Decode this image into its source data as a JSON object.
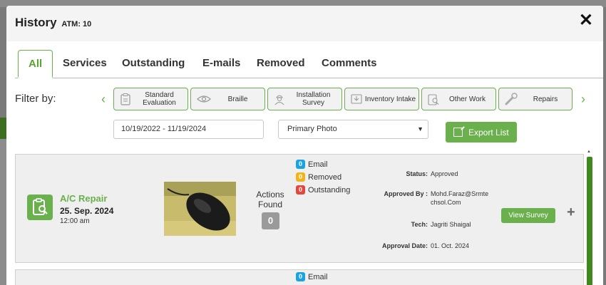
{
  "modal": {
    "title": "History",
    "subtitle": "ATM: 10",
    "close_label": "✕"
  },
  "tabs": [
    {
      "label": "All",
      "active": true
    },
    {
      "label": "Services"
    },
    {
      "label": "Outstanding"
    },
    {
      "label": "E-mails"
    },
    {
      "label": "Removed"
    },
    {
      "label": "Comments"
    }
  ],
  "filter": {
    "label": "Filter by:",
    "prev": "‹",
    "next": "›",
    "chips": [
      {
        "label": "Standard Evaluation",
        "icon": "clipboard-icon"
      },
      {
        "label": "Braille",
        "icon": "eye-icon"
      },
      {
        "label": "Installation Survey",
        "icon": "worker-icon"
      },
      {
        "label": "Inventory Intake",
        "icon": "inbox-icon"
      },
      {
        "label": "Other Work",
        "icon": "clipboard-search-icon"
      },
      {
        "label": "Repairs",
        "icon": "wrench-icon"
      }
    ]
  },
  "date_range": "10/19/2022 - 11/19/2024",
  "photo_select": {
    "value": "Primary Photo",
    "arrow": "▼"
  },
  "export": {
    "label": "Export List"
  },
  "items": [
    {
      "service": "A/C Repair",
      "date": "25. Sep. 2024",
      "time": "12:00 am",
      "actions_label": "Actions Found",
      "actions_count": "0",
      "counts": [
        {
          "n": "0",
          "label": "Email",
          "color": "#1aa3e0"
        },
        {
          "n": "0",
          "label": "Removed",
          "color": "#f0b41c"
        },
        {
          "n": "0",
          "label": "Outstanding",
          "color": "#e2483d"
        }
      ],
      "status_label": "Status:",
      "status": "Approved",
      "approved_by_label": "Approved By :",
      "approved_by_line1": "Mohd.Faraz@Srmte",
      "approved_by_line2": "chsol.Com",
      "tech_label": "Tech:",
      "tech": "Jagriti Shaigal",
      "approval_date_label": "Approval Date:",
      "approval_date": "01. Oct. 2024",
      "view_label": "View Survey",
      "expand": "+"
    },
    {
      "counts": [
        {
          "n": "0",
          "label": "Email",
          "color": "#1aa3e0"
        }
      ]
    }
  ],
  "colors": {
    "accent": "#6ab04c",
    "scroll": "#3f8a1f"
  }
}
